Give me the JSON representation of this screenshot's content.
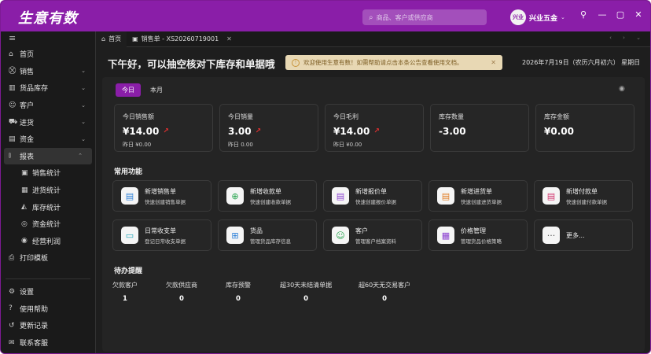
{
  "app": {
    "title": "生意有数",
    "search_placeholder": "商品、客户或供应商",
    "shop_badge": "兴业",
    "shop_name": "兴业五金"
  },
  "window_controls": {
    "pin": "⚲",
    "minimize": "—",
    "maximize": "▢",
    "close": "✕"
  },
  "sidebar": {
    "menu_icon": "≡",
    "items": [
      {
        "icon": "⌂",
        "label": "首页",
        "chevron": ""
      },
      {
        "icon": "⛒",
        "label": "销售",
        "chevron": "⌄"
      },
      {
        "icon": "▥",
        "label": "货品库存",
        "chevron": "⌄"
      },
      {
        "icon": "☺",
        "label": "客户",
        "chevron": "⌄"
      },
      {
        "icon": "⛟",
        "label": "进货",
        "chevron": "⌄"
      },
      {
        "icon": "▤",
        "label": "资金",
        "chevron": "⌄"
      },
      {
        "icon": "⫾",
        "label": "报表",
        "chevron": "⌃"
      }
    ],
    "sub_items": [
      {
        "icon": "▣",
        "label": "销售统计"
      },
      {
        "icon": "▦",
        "label": "进货统计"
      },
      {
        "icon": "◭",
        "label": "库存统计"
      },
      {
        "icon": "◎",
        "label": "资金统计"
      },
      {
        "icon": "◉",
        "label": "经营利润"
      }
    ],
    "print": {
      "icon": "⎙",
      "label": "打印模板"
    },
    "bottom": [
      {
        "icon": "⚙",
        "label": "设置"
      },
      {
        "icon": "?",
        "label": "使用帮助"
      },
      {
        "icon": "↺",
        "label": "更新记录"
      },
      {
        "icon": "✉",
        "label": "联系客服"
      }
    ]
  },
  "tabs": [
    {
      "icon": "⌂",
      "label": "首页"
    },
    {
      "icon": "▣",
      "label": "销售单 - XS20260719001",
      "close": "✕"
    }
  ],
  "tab_nav": "‹ ›  ⌄",
  "greeting": "下午好，可以抽空核对下库存和单据哦",
  "notice": {
    "icon": "!",
    "text": "欢迎使用生意有数！如需帮助请点击本条公告查看使用文档。",
    "close": "✕"
  },
  "date": "2026年7月19日（农历六月初六） 星期日",
  "period_tabs": [
    "今日",
    "本月"
  ],
  "eye_icon": "◉",
  "stats": [
    {
      "label": "今日销售额",
      "value": "¥14.00",
      "trend": "↗",
      "yesterday": "昨日 ¥0.00"
    },
    {
      "label": "今日销量",
      "value": "3.00",
      "trend": "↗",
      "yesterday": "昨日 0.00"
    },
    {
      "label": "今日毛利",
      "value": "¥14.00",
      "trend": "↗",
      "yesterday": "昨日 ¥0.00"
    },
    {
      "label": "库存数量",
      "value": "-3.00",
      "trend": "",
      "yesterday": ""
    },
    {
      "label": "库存金额",
      "value": "¥0.00",
      "trend": "",
      "yesterday": ""
    }
  ],
  "common_title": "常用功能",
  "functions": [
    {
      "icon": "▤",
      "color": "#2a7fd8",
      "title": "新增销售单",
      "desc": "快速创建销售单据"
    },
    {
      "icon": "⊕",
      "color": "#22a34a",
      "title": "新增收款单",
      "desc": "快速创建收款单据"
    },
    {
      "icon": "▤",
      "color": "#8a3fd0",
      "title": "新增报价单",
      "desc": "快速创建报价单据"
    },
    {
      "icon": "▤",
      "color": "#e07a20",
      "title": "新增进货单",
      "desc": "快速创建进货单据"
    },
    {
      "icon": "▤",
      "color": "#d0306a",
      "title": "新增付款单",
      "desc": "快速创建付款单据"
    },
    {
      "icon": "▭",
      "color": "#1aa4b8",
      "title": "日常收支单",
      "desc": "登记日常收支单据"
    },
    {
      "icon": "⊞",
      "color": "#2a7fd8",
      "title": "货品",
      "desc": "管理货品库存信息"
    },
    {
      "icon": "☺",
      "color": "#22a34a",
      "title": "客户",
      "desc": "管理客户档案资料"
    },
    {
      "icon": "▦",
      "color": "#8a3fd0",
      "title": "价格管理",
      "desc": "管理货品价格策略"
    },
    {
      "icon": "···",
      "color": "#555555",
      "title": "更多...",
      "desc": ""
    }
  ],
  "todo_title": "待办提醒",
  "todos": [
    {
      "label": "欠款客户",
      "value": "1"
    },
    {
      "label": "欠款供应商",
      "value": "0"
    },
    {
      "label": "库存预警",
      "value": "0"
    },
    {
      "label": "超30天未结清单据",
      "value": "0"
    },
    {
      "label": "超60天无交易客户",
      "value": "0"
    }
  ]
}
